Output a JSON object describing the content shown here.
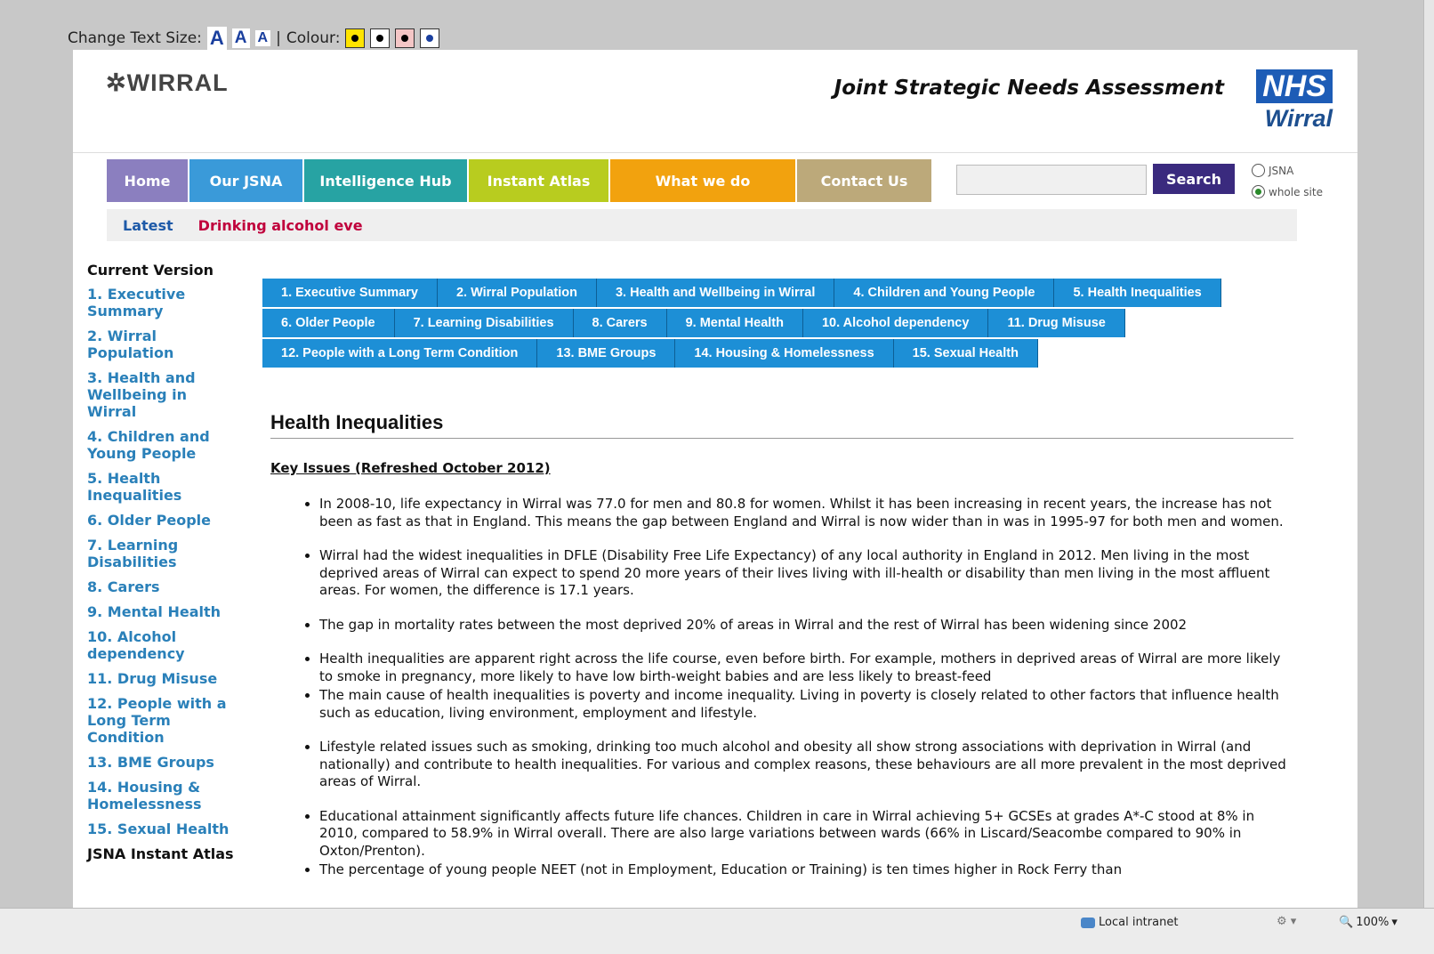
{
  "toolbar": {
    "text_size_label": "Change Text Size:",
    "size_options": [
      "A",
      "A",
      "A"
    ],
    "separator": "|",
    "colour_label": "Colour:",
    "colour_swatches": [
      {
        "bg": "#ffe400",
        "dot": "#000000"
      },
      {
        "bg": "#ffffff",
        "dot": "#000000"
      },
      {
        "bg": "#f4c6c6",
        "dot": "#000000"
      },
      {
        "bg": "#ffffff",
        "dot": "#1a3f9e"
      }
    ]
  },
  "header": {
    "logo": "WIRRAL",
    "title": "Joint Strategic Needs Assessment",
    "nhs_logo": "NHS",
    "nhs_sub": "Wirral"
  },
  "nav": [
    {
      "label": "Home",
      "color": "#8b7fbf"
    },
    {
      "label": "Our JSNA",
      "color": "#3a9ad9"
    },
    {
      "label": "Intelligence Hub",
      "color": "#27a3a3"
    },
    {
      "label": "Instant Atlas",
      "color": "#b8cc1f"
    },
    {
      "label": "What we do",
      "color": "#f2a20e"
    },
    {
      "label": "Contact Us",
      "color": "#bca97a"
    }
  ],
  "search": {
    "button": "Search",
    "radio_jsna": "JSNA",
    "radio_whole_site": "whole site"
  },
  "latest": {
    "label": "Latest",
    "message": "Drinking alcohol eve"
  },
  "sidebar": {
    "heading": "Current Version",
    "items": [
      "1. Executive Summary",
      "2. Wirral Population",
      "3. Health and Wellbeing in Wirral",
      "4. Children and Young People",
      "5. Health Inequalities",
      "6. Older People",
      "7. Learning Disabilities",
      "8. Carers",
      "9. Mental Health",
      "10. Alcohol dependency",
      "11. Drug Misuse",
      "12. People with a Long Term Condition",
      "13. BME Groups",
      "14. Housing & Homelessness",
      "15. Sexual Health"
    ],
    "instant_atlas": "JSNA Instant Atlas"
  },
  "tabs": {
    "row1": [
      "1. Executive Summary",
      "2. Wirral Population",
      "3. Health and Wellbeing in Wirral",
      "4. Children and Young People",
      "5. Health Inequalities"
    ],
    "row2": [
      "6. Older People",
      "7. Learning Disabilities",
      "8. Carers",
      "9. Mental Health",
      "10. Alcohol dependency",
      "11. Drug Misuse"
    ],
    "row3": [
      "12. People with a Long Term Condition",
      "13. BME Groups",
      "14. Housing & Homelessness",
      "15. Sexual Health"
    ]
  },
  "content": {
    "heading": "Health Inequalities",
    "subheading": "Key Issues (Refreshed October 2012)",
    "bullets": [
      "In 2008-10, life expectancy in Wirral was 77.0 for men and 80.8 for women. Whilst it has been increasing in recent years, the increase has not been as fast as that in England. This means the gap between England and Wirral is now wider than in was in 1995-97 for both men and women.",
      "Wirral had the widest inequalities in DFLE (Disability Free Life Expectancy) of any local authority in England in 2012. Men living in the most deprived areas of Wirral can expect to spend 20 more years of their lives living with ill-health or disability than men living in the most affluent areas. For women, the difference is 17.1 years.",
      "The gap in mortality rates between the most deprived 20% of areas in Wirral and the rest of Wirral has been widening since 2002",
      "Health inequalities are apparent right across the life course, even before birth. For example, mothers in deprived areas of Wirral are more likely to smoke in pregnancy, more likely to have low birth-weight babies and are less likely to breast-feed",
      "The main cause of health inequalities is poverty and income inequality. Living in poverty is closely related to other factors that influence health such as education, living environment, employment and lifestyle.",
      "Lifestyle related issues such as smoking, drinking too much alcohol and obesity all show strong associations with deprivation in Wirral (and nationally) and contribute to health inequalities. For various and complex reasons, these behaviours are all more prevalent in the most deprived areas of Wirral.",
      "Educational attainment significantly affects future life chances. Children in care in Wirral achieving 5+ GCSEs at grades A*-C stood at 8% in 2010, compared to 58.9% in Wirral overall. There are also large variations between wards (66% in Liscard/Seacombe compared to 90% in Oxton/Prenton).",
      "The percentage of young people NEET (not in Employment, Education or Training) is ten times higher in Rock Ferry than"
    ]
  },
  "statusbar": {
    "zone": "Local intranet",
    "zoom": "100%"
  }
}
